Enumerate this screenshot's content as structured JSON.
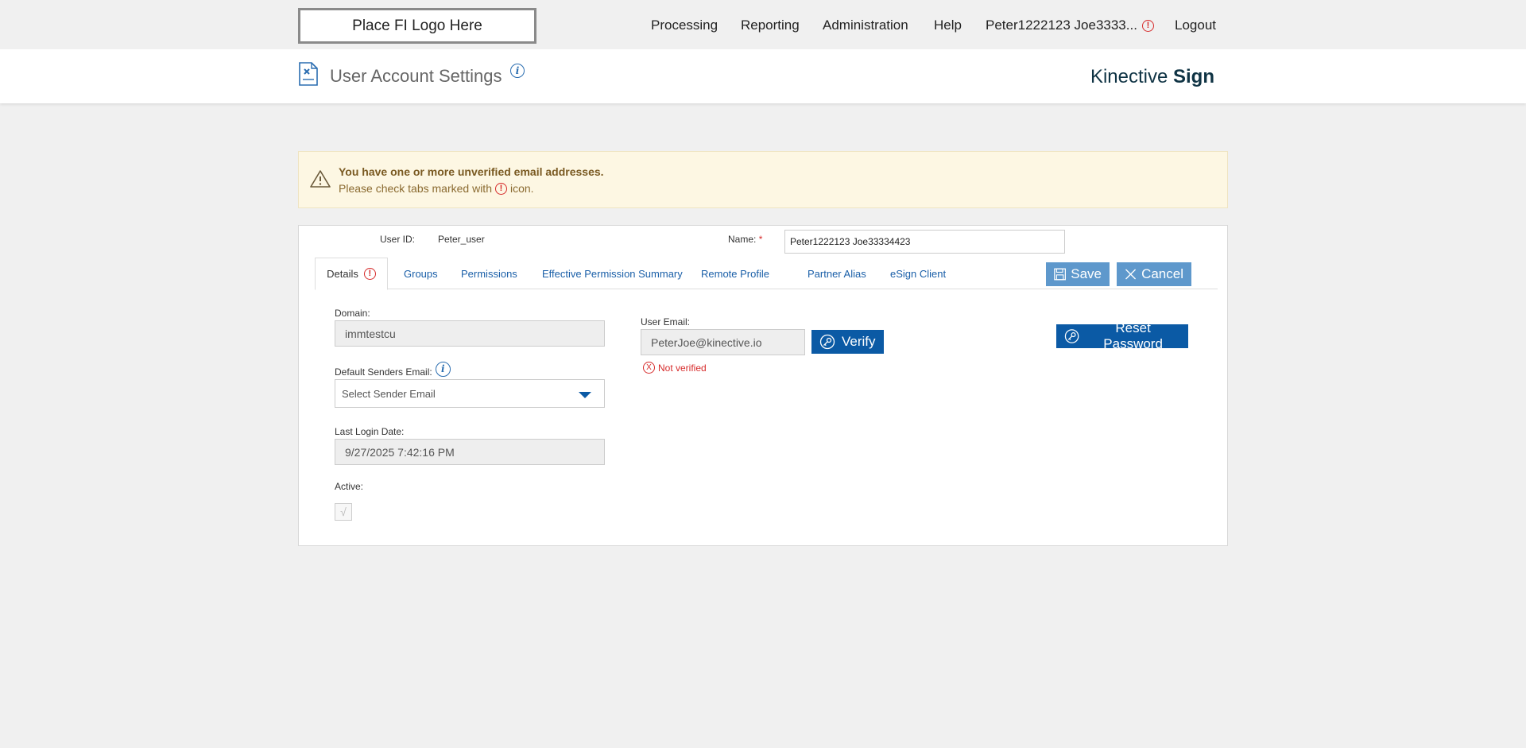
{
  "topbar": {
    "logo": "Place FI Logo Here",
    "nav": {
      "processing": "Processing",
      "reporting": "Reporting",
      "administration": "Administration",
      "help": "Help",
      "user": "Peter1222123 Joe3333...",
      "logout": "Logout"
    },
    "alert_icon": "!"
  },
  "header": {
    "title": "User Account Settings",
    "info_icon": "i",
    "brand_light": "Kinective",
    "brand_bold": "Sign"
  },
  "banner": {
    "title": "You have one or more unverified email addresses.",
    "text_before": "Please check tabs marked with",
    "text_after": "icon.",
    "alert_icon": "!"
  },
  "account": {
    "user_id_label": "User ID:",
    "user_id": "Peter_user",
    "name_label": "Name:",
    "required_mark": "*",
    "name_value": "Peter1222123 Joe33334423"
  },
  "tabs": {
    "details": "Details",
    "groups": "Groups",
    "permissions": "Permissions",
    "effective": "Effective Permission Summary",
    "remote": "Remote Profile",
    "partner": "Partner Alias",
    "esign": "eSign Client",
    "alert_icon": "!"
  },
  "actions": {
    "save": "Save",
    "cancel": "Cancel",
    "verify": "Verify",
    "reset_password": "Reset Password"
  },
  "details": {
    "domain_label": "Domain:",
    "domain_value": "immtestcu",
    "default_sender_label": "Default Senders Email:",
    "default_sender_placeholder": "Select Sender Email",
    "last_login_label": "Last Login Date:",
    "last_login_value": "9/27/2025 7:42:16 PM",
    "active_label": "Active:",
    "active_checked": true,
    "checkmark": "√",
    "user_email_label": "User Email:",
    "user_email_value": "PeterJoe@kinective.io",
    "email_status": "Not verified",
    "x_icon": "X"
  },
  "colors": {
    "primary": "#0b5aa5",
    "primary_light": "#5e98cc",
    "link": "#1a5fa8",
    "error": "#d62a2a",
    "warning_bg": "#fdf7e3"
  }
}
